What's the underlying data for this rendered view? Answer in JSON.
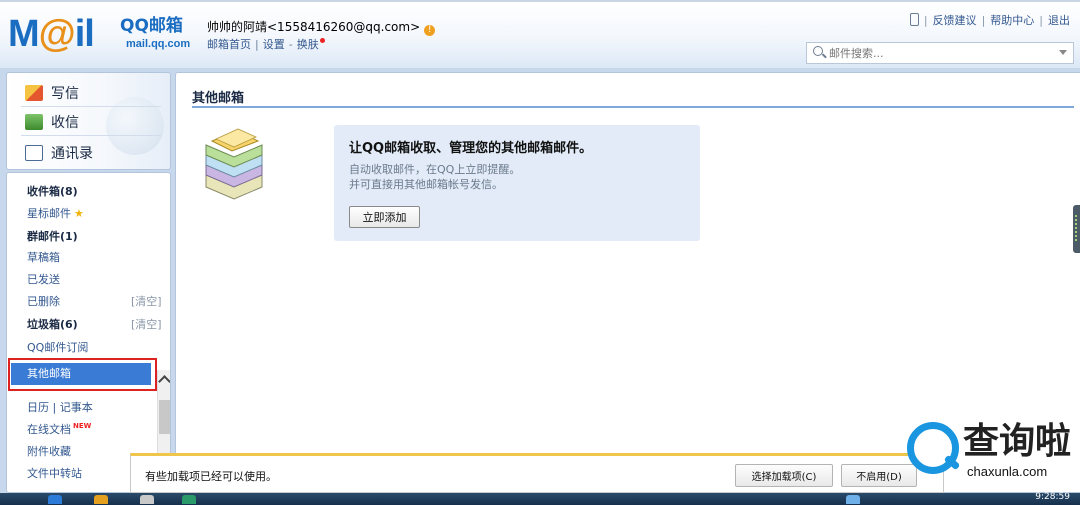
{
  "header": {
    "logo_text": "M@il",
    "logo_cn": "QQ邮箱",
    "logo_domain": "mail.qq.com",
    "user": "帅帅的阿靖<1558416260@qq.com>",
    "user_links": [
      "邮箱首页",
      "设置",
      "换肤"
    ],
    "top_links": [
      "反馈建议",
      "帮助中心",
      "退出"
    ],
    "search_placeholder": "邮件搜索..."
  },
  "sidebar": {
    "actions": [
      {
        "label": "写信",
        "icon": "pencil-icon"
      },
      {
        "label": "收信",
        "icon": "inbox-icon"
      },
      {
        "label": "通讯录",
        "icon": "address-book-icon"
      }
    ],
    "folders": [
      {
        "label": "收件箱(8)",
        "bold": true
      },
      {
        "label": "星标邮件",
        "bold": false
      },
      {
        "label": "群邮件(1)",
        "bold": true
      },
      {
        "label": "草稿箱",
        "bold": false
      },
      {
        "label": "已发送",
        "bold": false
      },
      {
        "label": "已删除",
        "bold": false
      },
      {
        "label": "垃圾箱(6)",
        "bold": true
      },
      {
        "label": "QQ邮件订阅",
        "bold": false
      },
      {
        "label": "其他邮箱",
        "bold": false,
        "selected": true
      },
      {
        "label": "日历 | 记事本",
        "bold": false
      },
      {
        "label": "在线文档",
        "bold": false
      },
      {
        "label": "附件收藏",
        "bold": false
      },
      {
        "label": "文件中转站",
        "bold": false
      }
    ],
    "clear_label": "[清空]",
    "new_badge": "NEW"
  },
  "content": {
    "title": "其他邮箱",
    "promo_title": "让QQ邮箱收取、管理您的其他邮箱邮件。",
    "promo_line1": "自动收取邮件，在QQ上立即提醒。",
    "promo_line2": "并可直接用其他邮箱帐号发信。",
    "add_button": "立即添加"
  },
  "notification": {
    "text": "有些加载项已经可以使用。",
    "choose_button": "选择加载项(C)",
    "disable_button": "不启用(D)"
  },
  "watermark": {
    "cn": "查询啦",
    "domain": "chaxunla.com"
  },
  "taskbar": {
    "clock": "9:28:59"
  },
  "colors": {
    "accent": "#3a7bd5",
    "header_blue": "#1b6dc1",
    "highlight": "#dd2222",
    "promo_bg": "#e2ebf7"
  }
}
